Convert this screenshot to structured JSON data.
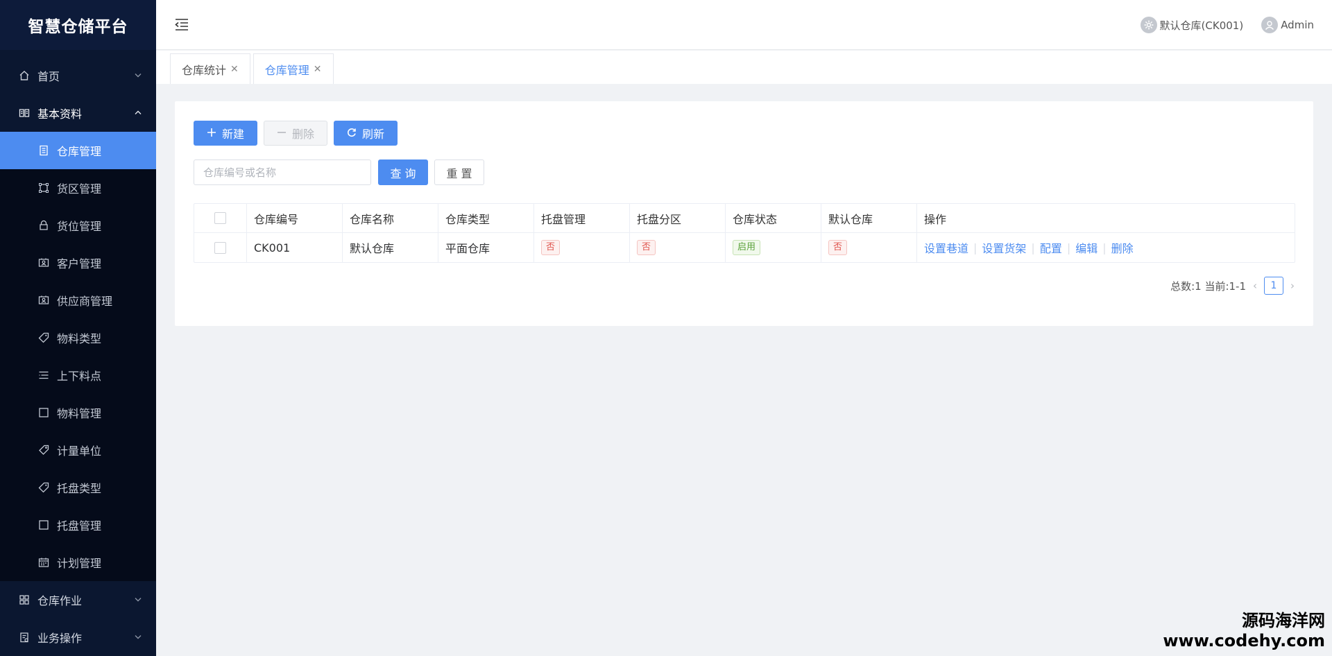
{
  "app": {
    "title": "智慧仓储平台"
  },
  "sidebar": {
    "items": [
      {
        "label": "首页",
        "icon": "home-icon",
        "arrow": "down"
      },
      {
        "label": "基本资料",
        "icon": "book-icon",
        "arrow": "up"
      }
    ],
    "sub_items": [
      {
        "label": "仓库管理",
        "icon": "document-icon",
        "active": true
      },
      {
        "label": "货区管理",
        "icon": "area-icon"
      },
      {
        "label": "货位管理",
        "icon": "lock-icon"
      },
      {
        "label": "客户管理",
        "icon": "contact-card-icon"
      },
      {
        "label": "供应商管理",
        "icon": "contact-card-icon"
      },
      {
        "label": "物料类型",
        "icon": "tag-icon"
      },
      {
        "label": "上下料点",
        "icon": "list-icon"
      },
      {
        "label": "物料管理",
        "icon": "square-icon"
      },
      {
        "label": "计量单位",
        "icon": "price-tag-icon"
      },
      {
        "label": "托盘类型",
        "icon": "tag-icon"
      },
      {
        "label": "托盘管理",
        "icon": "square-icon"
      },
      {
        "label": "计划管理",
        "icon": "calendar-icon"
      }
    ],
    "bottom_items": [
      {
        "label": "仓库作业",
        "icon": "grid-icon",
        "arrow": "down"
      },
      {
        "label": "业务操作",
        "icon": "clipboard-icon",
        "arrow": "down"
      }
    ]
  },
  "header": {
    "warehouse_label": "默认仓库(CK001)",
    "user_label": "Admin"
  },
  "tabs": [
    {
      "label": "仓库统计",
      "active": false
    },
    {
      "label": "仓库管理",
      "active": true
    }
  ],
  "toolbar": {
    "new_label": "新建",
    "delete_label": "删除",
    "refresh_label": "刷新"
  },
  "search": {
    "placeholder": "仓库编号或名称",
    "query_label": "查 询",
    "reset_label": "重 置"
  },
  "table": {
    "columns": [
      "仓库编号",
      "仓库名称",
      "仓库类型",
      "托盘管理",
      "托盘分区",
      "仓库状态",
      "默认仓库",
      "操作"
    ],
    "rows": [
      {
        "code": "CK001",
        "name": "默认仓库",
        "type": "平面仓库",
        "pallet_mgmt": "否",
        "pallet_zone": "否",
        "status": "启用",
        "is_default": "否",
        "actions": [
          "设置巷道",
          "设置货架",
          "配置",
          "编辑",
          "删除"
        ]
      }
    ]
  },
  "pager": {
    "summary": "总数:1 当前:1-1",
    "current_page": "1"
  },
  "watermark": {
    "line1": "源码海洋网",
    "line2": "www.codehy.com"
  },
  "colors": {
    "primary": "#4d8cf0",
    "sidebar_bg": "#0b1730",
    "danger_tag": "#e0564f",
    "success_tag": "#5aa13a"
  }
}
